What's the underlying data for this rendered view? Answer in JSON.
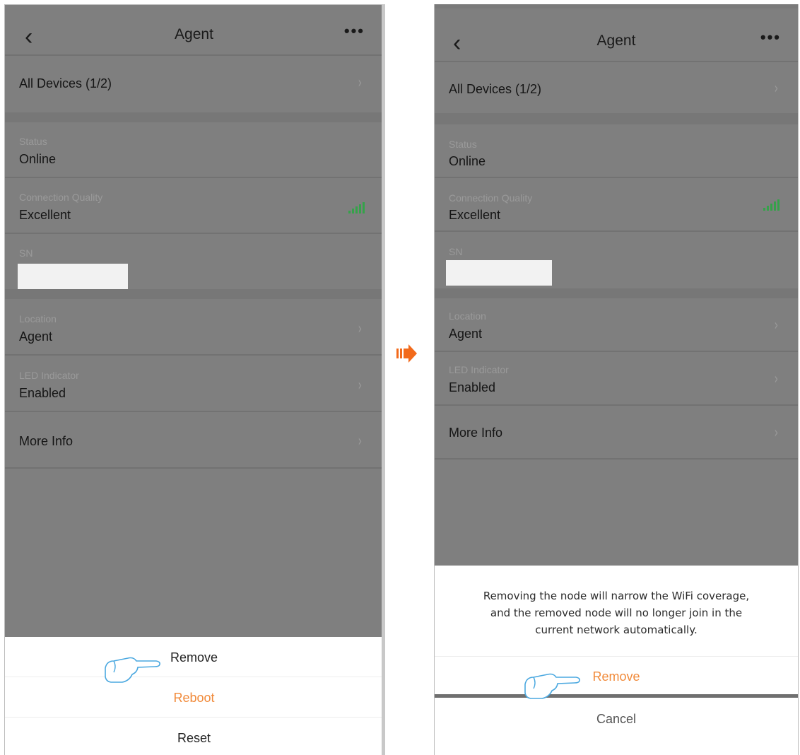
{
  "left_screen": {
    "nav": {
      "back_icon": "chevron-left-icon",
      "title": "Agent",
      "more_icon": "more-dots-icon"
    },
    "all_devices": {
      "label": "All Devices (1/2)"
    },
    "status": {
      "label": "Status",
      "value": "Online"
    },
    "connection_quality": {
      "label": "Connection Quality",
      "value": "Excellent",
      "icon": "signal-bars-icon"
    },
    "sn": {
      "label": "SN",
      "value": ""
    },
    "location": {
      "label": "Location",
      "value": "Agent"
    },
    "led": {
      "label": "LED Indicator",
      "value": "Enabled"
    },
    "more_info": {
      "label": "More Info"
    },
    "action_sheet": {
      "remove": "Remove",
      "reboot": "Reboot",
      "reset": "Reset"
    }
  },
  "right_screen": {
    "nav": {
      "back_icon": "chevron-left-icon",
      "title": "Agent",
      "more_icon": "more-dots-icon"
    },
    "all_devices": {
      "label": "All Devices (1/2)"
    },
    "status": {
      "label": "Status",
      "value": "Online"
    },
    "connection_quality": {
      "label": "Connection Quality",
      "value": "Excellent",
      "icon": "signal-bars-icon"
    },
    "sn": {
      "label": "SN",
      "value": ""
    },
    "location": {
      "label": "Location",
      "value": "Agent"
    },
    "led": {
      "label": "LED Indicator",
      "value": "Enabled"
    },
    "more_info": {
      "label": "More Info"
    },
    "dialog": {
      "message_line1": "Removing the node will narrow the WiFi coverage,",
      "message_line2": "and the removed node will no longer join in the",
      "message_line3": "current network automatically.",
      "remove": "Remove",
      "cancel": "Cancel"
    }
  },
  "transition_icon": "orange-right-arrow-icon",
  "pointer_icon": "pointing-hand-icon",
  "colors": {
    "accent_orange": "#f18a3a",
    "overlay_gray": "#7f7f7f",
    "signal_green": "#35a24a",
    "hand_outline": "#4aa8e0"
  }
}
